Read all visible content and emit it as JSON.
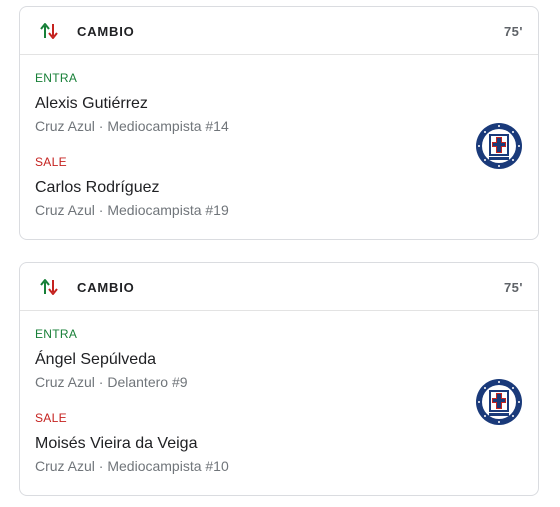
{
  "colors": {
    "in": "#188038",
    "out": "#c5221f",
    "crest_blue": "#1a3a7a"
  },
  "cards": [
    {
      "event": "CAMBIO",
      "minute": "75'",
      "in_label": "ENTRA",
      "in_player": "Alexis Gutiérrez",
      "in_info": "Cruz Azul · Mediocampista #14",
      "out_label": "SALE",
      "out_player": "Carlos Rodríguez",
      "out_info": "Cruz Azul · Mediocampista #19",
      "icon": "substitution-arrows-icon",
      "crest_icon": "cruz-azul-crest-icon"
    },
    {
      "event": "CAMBIO",
      "minute": "75'",
      "in_label": "ENTRA",
      "in_player": "Ángel Sepúlveda",
      "in_info": "Cruz Azul · Delantero #9",
      "out_label": "SALE",
      "out_player": "Moisés Vieira da Veiga",
      "out_info": "Cruz Azul · Mediocampista #10",
      "icon": "substitution-arrows-icon",
      "crest_icon": "cruz-azul-crest-icon"
    }
  ]
}
